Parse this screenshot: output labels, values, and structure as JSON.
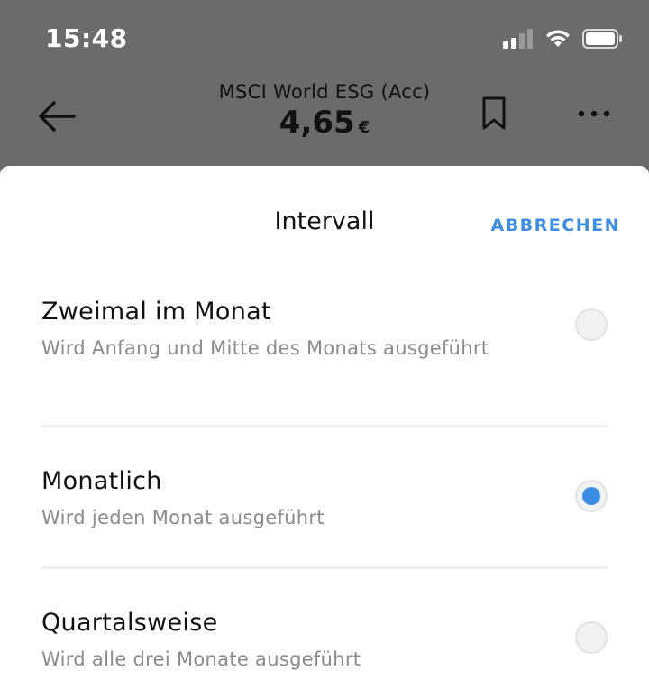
{
  "status_bar": {
    "time": "15:48",
    "icons": [
      "signal-icon",
      "wifi-icon",
      "battery-icon"
    ]
  },
  "header": {
    "title": "MSCI World ESG (Acc)",
    "price": "4,65",
    "currency": "€",
    "icons": [
      "back-arrow-icon",
      "bookmark-icon",
      "more-icon"
    ]
  },
  "sheet": {
    "title": "Intervall",
    "cancel_label": "ABBRECHEN",
    "options": [
      {
        "title": "Zweimal im Monat",
        "description": "Wird Anfang und Mitte des Monats ausgeführt",
        "selected": false
      },
      {
        "title": "Monatlich",
        "description": "Wird jeden Monat ausgeführt",
        "selected": true
      },
      {
        "title": "Quartalsweise",
        "description": "Wird alle drei Monate ausgeführt",
        "selected": false
      }
    ]
  },
  "colors": {
    "accent": "#3b8de6",
    "overlay": "#6b6b6b",
    "sheet_background": "#ffffff",
    "secondary_text": "#8a8a8a"
  }
}
